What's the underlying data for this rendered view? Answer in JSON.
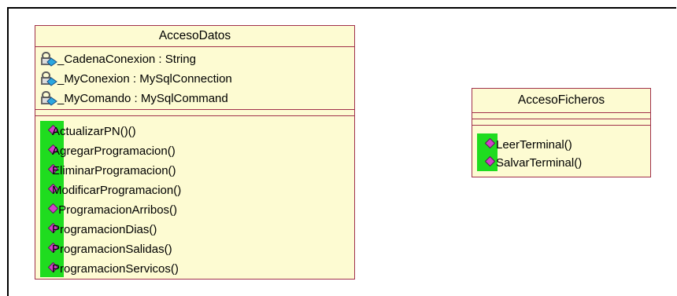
{
  "classes": {
    "acceso_datos": {
      "name": "AccesoDatos",
      "attributes": [
        "_CadenaConexion : String",
        "_MyConexion : MySqlConnection",
        "_MyComando : MySqlCommand"
      ],
      "operations": [
        "ActualizarPN()()",
        "AgregarProgramacion()",
        "EliminarProgramacion()",
        "ModificarProgramacion()",
        " ProgramacionArribos()",
        "ProgramacionDias()",
        "ProgramacionSalidas()",
        "ProgramacionServicos()"
      ]
    },
    "acceso_ficheros": {
      "name": "AccesoFicheros",
      "attributes": [],
      "operations": [
        "LeerTerminal()",
        "SalvarTerminal()"
      ]
    }
  },
  "colors": {
    "class_fill": "#fdfbd2",
    "class_border": "#a0304a",
    "operation_highlight": "#1fdc1f",
    "operation_icon": "#d040c8"
  },
  "icons": {
    "attribute": "protected-attribute-icon",
    "operation": "public-operation-icon"
  }
}
